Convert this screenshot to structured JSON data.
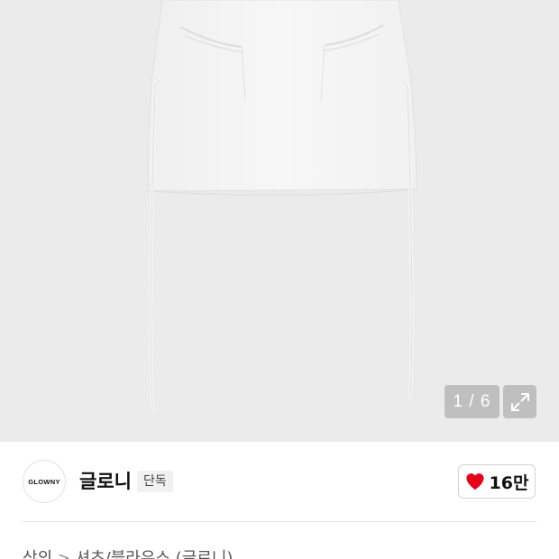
{
  "gallery": {
    "counter": "1 / 6",
    "expand_icon": "expand-arrows-icon",
    "background_color": "#ebebeb"
  },
  "brand": {
    "logo_text": "GLOWNY",
    "name": "글로니",
    "badge": "단독"
  },
  "like": {
    "icon": "heart-icon",
    "icon_color": "#e3001b",
    "count": "16만"
  },
  "breadcrumb": {
    "items": [
      "상의",
      "셔츠/블라우스 (글로니)"
    ],
    "separator": ">"
  }
}
